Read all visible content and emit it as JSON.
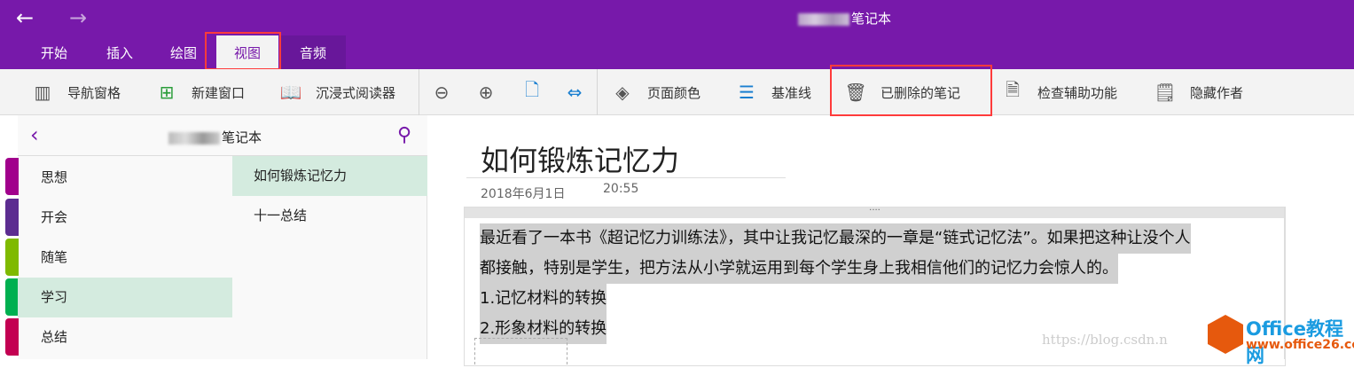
{
  "titlebar": {
    "title": "笔记本",
    "back": "←",
    "forward": "→"
  },
  "tabs": [
    "开始",
    "插入",
    "绘图",
    "视图",
    "音频"
  ],
  "toolbar": {
    "items": [
      {
        "label": "导航窗格",
        "icon": "navigation-pane-icon"
      },
      {
        "label": "新建窗口",
        "icon": "new-window-icon"
      },
      {
        "label": "沉浸式阅读器",
        "icon": "immersive-reader-icon"
      },
      {
        "label": "页面颜色",
        "icon": "page-color-icon"
      },
      {
        "label": "基准线",
        "icon": "rule-lines-icon"
      },
      {
        "label": "已删除的笔记",
        "icon": "trash-icon"
      },
      {
        "label": "检查辅助功能",
        "icon": "accessibility-check-icon"
      },
      {
        "label": "隐藏作者",
        "icon": "hide-authors-icon"
      }
    ]
  },
  "notebook": {
    "title": "笔记本",
    "sections": [
      "思想",
      "开会",
      "随笔",
      "学习",
      "总结"
    ],
    "section_colors": [
      "#a1008c",
      "#5c2d91",
      "#7fba00",
      "#00b050",
      "#c30052"
    ],
    "pages": [
      "如何锻炼记忆力",
      "十一总结"
    ]
  },
  "page": {
    "title": "如何锻炼记忆力",
    "date": "2018年6月1日",
    "time": "20:55",
    "paragraphs": [
      "最近看了一本书《超记忆力训练法》，其中让我记忆最深的一章是“链式记忆法”。如果把这种让没个人",
      "都接触，特别是学生，把方法从小学就运用到每个学生身上我相信他们的记忆力会惊人的。",
      "1.记忆材料的转换",
      "2.形象材料的转换"
    ]
  },
  "watermark": {
    "url": "https://blog.csdn.n",
    "logo_title": "Office教程网",
    "logo_url": "www.office26.com"
  }
}
